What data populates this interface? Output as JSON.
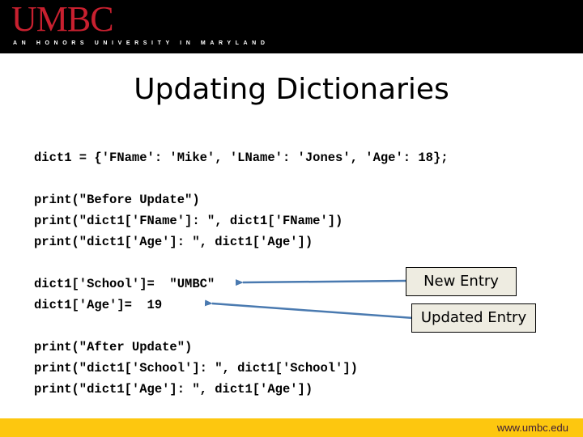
{
  "header": {
    "logo": "UMBC",
    "tagline": "AN HONORS UNIVERSITY IN MARYLAND"
  },
  "slide": {
    "title": "Updating Dictionaries",
    "code_lines": [
      "dict1 = {'FName': 'Mike', 'LName': 'Jones', 'Age': 18};",
      "print(\"Before Update\")",
      "print(\"dict1['FName']: \", dict1['FName'])",
      "print(\"dict1['Age']: \", dict1['Age'])",
      "dict1['School']=  \"UMBC\"",
      "dict1['Age']=  19",
      "print(\"After Update\")",
      "print(\"dict1['School']: \", dict1['School'])",
      "print(\"dict1['Age']: \", dict1['Age'])"
    ],
    "callouts": {
      "new_entry": "New Entry",
      "updated_entry": "Updated Entry"
    }
  },
  "footer": {
    "url": "www.umbc.edu"
  },
  "colors": {
    "logo_red": "#c8202f",
    "footer_gold": "#fdc70f",
    "arrow_blue": "#4a7ab0",
    "callout_fill": "#eeece1"
  }
}
